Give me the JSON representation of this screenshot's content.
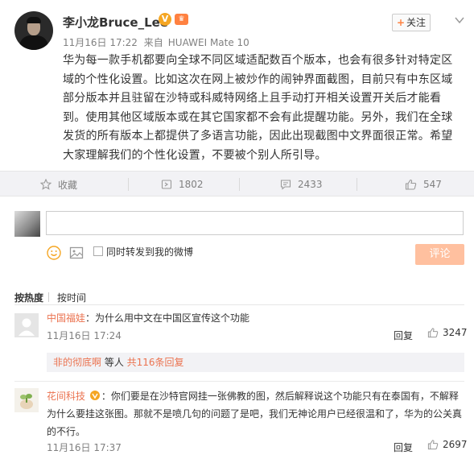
{
  "post": {
    "user_name": "李小龙Bruce_Lee",
    "vip_badge": "V",
    "level_badge": "♛",
    "date": "11月16日 17:22",
    "source_prefix": "来自",
    "source_device": "HUAWEI Mate 10",
    "follow_label": "关注",
    "text": "华为每一款手机都要向全球不同区域适配数百个版本，也会有很多针对特定区域的个性化设置。比如这次在网上被炒作的闹钟界面截图，目前只有中东区域部分版本并且驻留在沙特或科威特网络上且手动打开相关设置开关后才能看到。使用其他区域版本或在其它国家都不会有此提醒功能。另外，我们在全球发货的所有版本上都提供了多语言功能，因此出现截图中文界面很正常。希望大家理解我们的个性化设置，不要被个别人所引导。"
  },
  "actions": {
    "favorite": "收藏",
    "repost_count": "1802",
    "comment_count": "2433",
    "like_count": "547"
  },
  "composer": {
    "input_value": "",
    "repost_label": "同时转发到我的微博",
    "submit_label": "评论"
  },
  "sort": {
    "hot": "按热度",
    "time": "按时间"
  },
  "comments": [
    {
      "name": "中国福娃",
      "text": "：为什么用中文在中国区宣传这个功能",
      "time": "11月16日 17:24",
      "reply": "回复",
      "likes": "3247",
      "sub_user": "非的彻底啊",
      "sub_middle": " 等人 ",
      "sub_link": "共116条回复"
    },
    {
      "name": "花间科技",
      "text_line1": "：你们要是在沙特官网挂一张佛教的图，然后解释说这个功能只有在泰国有，不解释",
      "text_line2": "为什么要挂这张图。那就不是喷几句的问题了是吧，我们无神论用户已经很温和了，华为的公关真",
      "text_line3": "的不行。",
      "time": "11月16日 17:37",
      "reply": "回复",
      "likes": "2697"
    }
  ],
  "colors": {
    "accent": "#eb7350",
    "button_disabled": "#ffc09f",
    "bar_bg": "#f2f2f5"
  }
}
